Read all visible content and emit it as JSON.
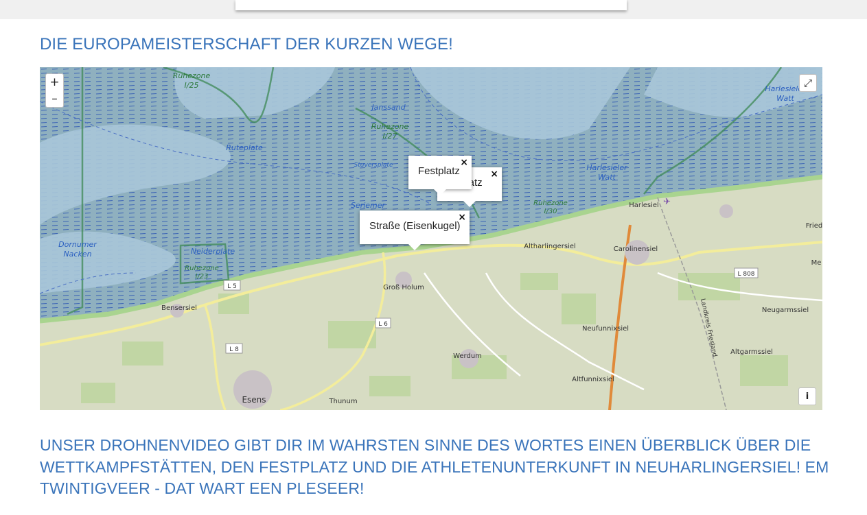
{
  "page": {
    "heading": "DIE EUROPAMEISTERSCHAFT DER KURZEN WEGE!",
    "paragraph": "UNSER DROHNENVIDEO GIBT DIR IM WAHRSTEN SINNE DES WORTES EINEN ÜBERBLICK ÜBER DIE WETTKAMPFSTÄTTEN, DEN FESTPLATZ UND DIE ATHLETENUNTERKUNFT IN NEUHARLINGERSIEL! EM TWINTIGVEER - DAT WART EEN PLESEER!"
  },
  "colors": {
    "heading": "#3a74ba",
    "sea": "#a9c7d9",
    "mudflat": "#8fb0bf",
    "land": "#d7dcc3",
    "reserve_border": "#3e8a55"
  },
  "map": {
    "controls": {
      "zoom_in": "+",
      "zoom_out": "–",
      "fullscreen_icon": "expand-icon",
      "fullscreen_glyph": "⤢",
      "info": "i"
    },
    "labels": {
      "ruhezone_125": "Ruhezone",
      "ruhezone_125_id": "I/25",
      "janssand": "Janssand",
      "ruhezone_127": "Ruhezone",
      "ruhezone_127_id": "I/27",
      "ruteplate": "Ruteplate",
      "stuversplate": "Stuversplate",
      "harlesieler_watt_top": "Harlesieler",
      "harlesieler_watt_top_2": "Watt",
      "harlesieler_watt": "Harlesieler",
      "harlesieler_watt_2": "Watt",
      "seriemer": "Seriemer",
      "ruhezone_130": "Ruhezone",
      "ruhezone_130_id": "I/30",
      "harlesiel": "Harlesiel",
      "dornumer_nacken": "Dornumer",
      "dornumer_nacken_2": "Nacken",
      "neiderplate": "Neiderplate",
      "ruhezone_123": "Ruhezone",
      "ruhezone_123_id": "I/23",
      "carolinensiel": "Carolinensiel",
      "fried": "Fried",
      "me": "Me",
      "l5": "L 5",
      "gross_holum": "Groß Holum",
      "altharlingersiel": "Altharlingersiel",
      "l808": "L 808",
      "bensersiel": "Bensersiel",
      "landkreis_friesland": "Landkreis Friesland",
      "neugarmssiel": "Neugarmssiel",
      "l6": "L 6",
      "neufunnixsiel": "Neufunnixsiel",
      "l8": "L 8",
      "werdum": "Werdum",
      "altgarmssiel": "Altgarmssiel",
      "altfunnixsiel": "Altfunnixsiel",
      "esens": "Esens",
      "thunum": "Thunum"
    },
    "popups": {
      "back_text": "platz",
      "front_text": "Festplatz",
      "strasse_text": "Straße (Eisenkugel)",
      "close": "×"
    }
  }
}
